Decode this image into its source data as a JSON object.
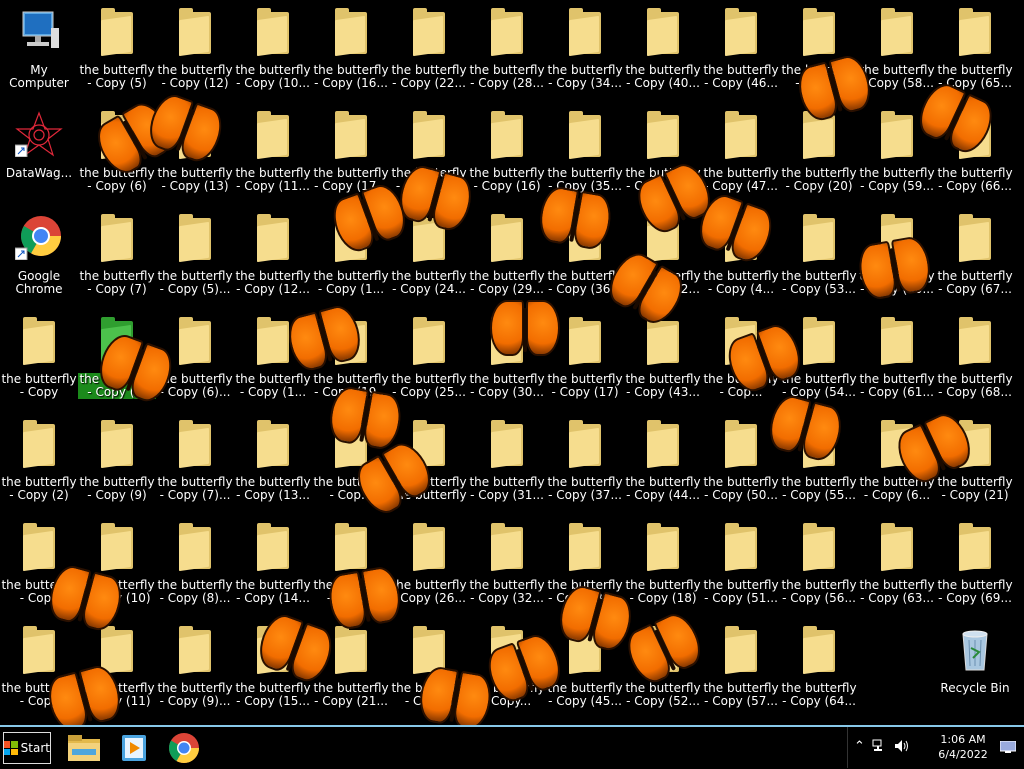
{
  "desktop": {
    "shortcuts": [
      {
        "name": "my-computer-icon",
        "label": "My Computer"
      },
      {
        "name": "datawag-icon",
        "label": "DataWag..."
      },
      {
        "name": "chrome-icon",
        "label": "Google Chrome"
      },
      {
        "name": "recycle-bin-icon",
        "label": "Recycle Bin"
      }
    ],
    "folder_labels": [
      [
        "- Copy (5)",
        "- Copy (12)",
        "- Copy (10...",
        "- Copy (16...",
        "- Copy (22...",
        "- Copy (28...",
        "- Copy (34...",
        "- Copy (40...",
        "- Copy (46...",
        "- Cop...)",
        "- Copy (58...",
        "- Copy (65..."
      ],
      [
        "- Copy (6)",
        "- Copy (13)",
        "- Copy (11...",
        "- Copy (17...",
        "- Copy (2...",
        "- Copy (16)",
        "- Copy (35...",
        "- Copy (41...",
        "- Copy (47...",
        "- Copy (20)",
        "- Copy (59...",
        "- Copy (66..."
      ],
      [
        "- Copy (7)",
        "- Copy (5)...",
        "- Copy (12...",
        "- Copy (1...",
        "- Copy (24...",
        "- Copy (29...",
        "- Copy (36...",
        "- Copy (42...",
        "- Copy (4...",
        "- Copy (53...",
        "- Copy (60...",
        "- Copy (67..."
      ],
      [
        "- Copy",
        "- Copy (8)",
        "- Copy (6)...",
        "- Copy (1...",
        "- Copy (19...",
        "- Copy (25...",
        "- Copy (30...",
        "- Copy (17)",
        "- Copy (43...",
        "- Cop...",
        "- Copy (54...",
        "- Copy (61...",
        "- Copy (68..."
      ],
      [
        "- Copy (2)",
        "- Copy (9)",
        "- Copy (7)...",
        "- Copy (13...",
        "- Cop...",
        "the butterfly",
        "- Copy (31...",
        "- Copy (37...",
        "- Copy (44...",
        "- Copy (50...",
        "- Copy (55...",
        "- Copy (6...",
        "- Copy (21)"
      ],
      [
        "- Copy",
        "- Copy (10)",
        "- Copy (8)...",
        "- Copy (14...",
        "- Copy...",
        "- Copy (26...",
        "- Copy (32...",
        "- Copy (38...",
        "- Copy (18)",
        "- Copy (51...",
        "- Copy (56...",
        "- Copy (63...",
        "- Copy (69..."
      ],
      [
        "- Copy",
        "- Copy (11)",
        "- Copy (9)...",
        "- Copy (15...",
        "- Copy (21...",
        "- Copy...",
        "- Copy...",
        "- Copy (45...",
        "- Copy (52...",
        "- Copy (57...",
        "- Copy (64..."
      ]
    ],
    "folder_name": "the butterfly"
  },
  "taskbar": {
    "start_label": "Start",
    "apps": [
      {
        "name": "file-explorer-icon"
      },
      {
        "name": "media-player-icon"
      },
      {
        "name": "chrome-taskbar-icon"
      }
    ],
    "tray": {
      "show_hidden_icon": "⌃",
      "time": "1:06 AM",
      "date": "6/4/2022"
    }
  }
}
